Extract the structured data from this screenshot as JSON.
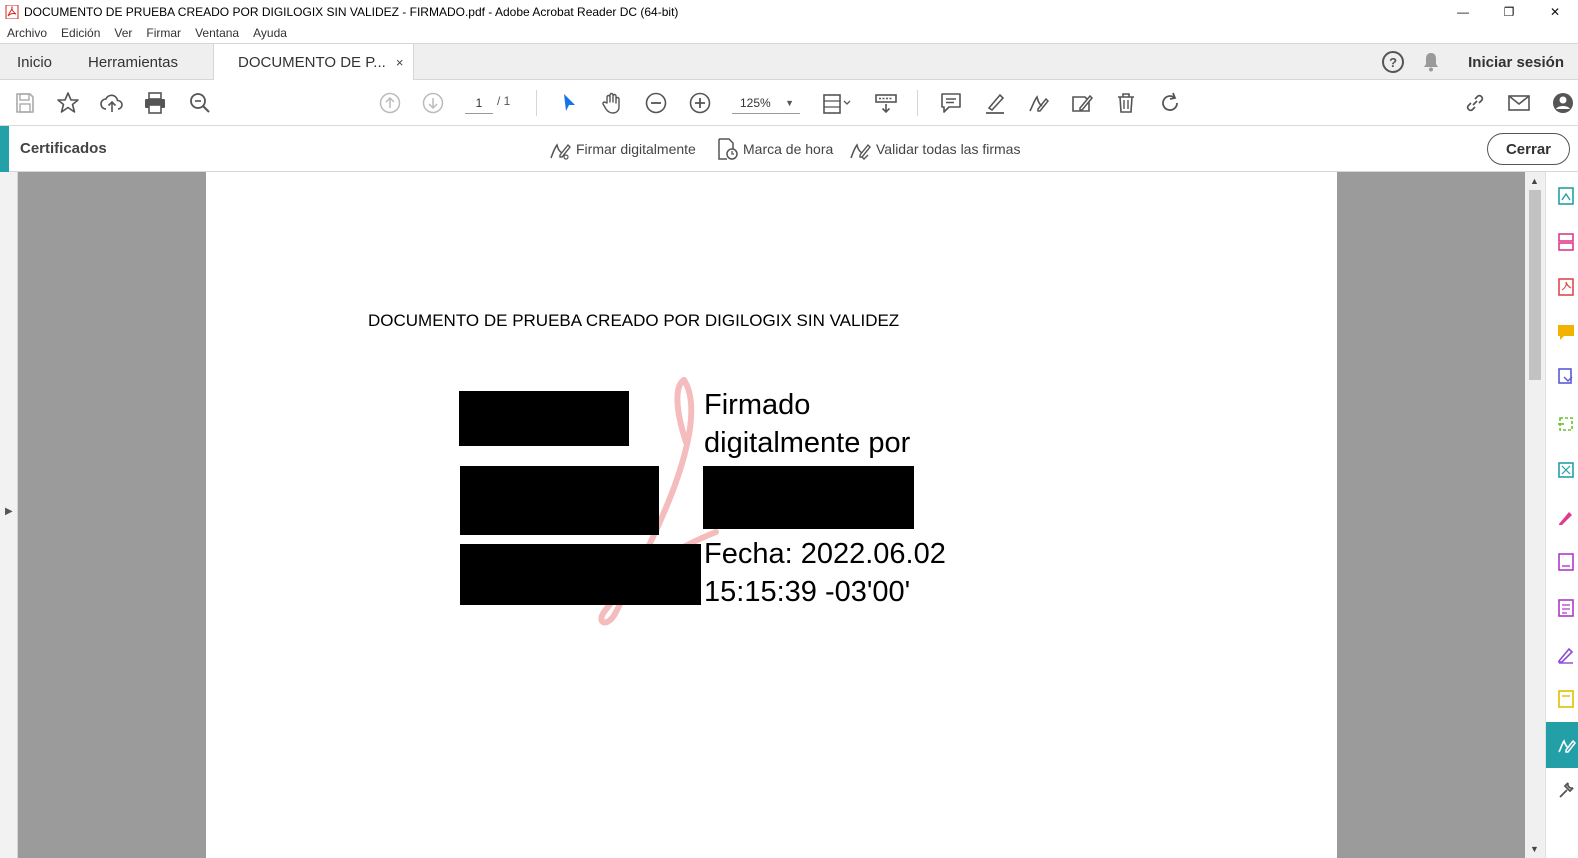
{
  "window": {
    "title": "DOCUMENTO DE PRUEBA CREADO POR DIGILOGIX SIN VALIDEZ - FIRMADO.pdf - Adobe Acrobat Reader DC (64-bit)",
    "minimize": "—",
    "restore": "❐",
    "close": "✕"
  },
  "menu": [
    "Archivo",
    "Edición",
    "Ver",
    "Firmar",
    "Ventana",
    "Ayuda"
  ],
  "tabs": {
    "home": "Inicio",
    "tools": "Herramientas",
    "document": "DOCUMENTO DE P...",
    "close_glyph": "×",
    "help_glyph": "?",
    "signin": "Iniciar sesión"
  },
  "toolbar": {
    "page_current": "1",
    "page_total": "/ 1",
    "zoom": "125%",
    "zoom_caret": "▼"
  },
  "certificates": {
    "label": "Certificados",
    "sign_digitally": "Firmar digitalmente",
    "timestamp": "Marca de hora",
    "validate_all": "Validar todas las firmas",
    "close": "Cerrar"
  },
  "document": {
    "heading": "DOCUMENTO DE PRUEBA CREADO POR DIGILOGIX SIN VALIDEZ",
    "sig_line1": "Firmado",
    "sig_line2": "digitalmente por",
    "sig_date1": "Fecha: 2022.06.02",
    "sig_date2": "15:15:39 -03'00'"
  },
  "colors": {
    "accent": "#24a1a8",
    "redaction": "#000000",
    "canvas_gray": "#9b9b9b",
    "select_blue": "#1473e6"
  }
}
